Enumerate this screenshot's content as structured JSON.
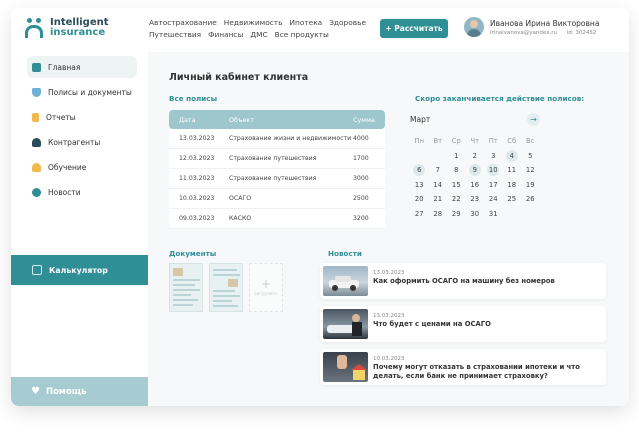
{
  "app": {
    "logo_line1": "Intelligent",
    "logo_line2": "insurance"
  },
  "topnav": [
    "Автострахование",
    "Недвижимость",
    "Ипотека",
    "Здоровье",
    "Путешествия",
    "Финансы",
    "ДМС",
    "Все продукты"
  ],
  "calc_button": "+ Рассчитать",
  "user": {
    "name": "Иванова Ирина Викторовна",
    "email": "irinaivanova@yandex.ru",
    "id": "id: 302452"
  },
  "sidebar": {
    "items": [
      {
        "label": "Главная",
        "icon": "home-icon",
        "color": "#2f8f95"
      },
      {
        "label": "Полисы и документы",
        "icon": "shield-icon",
        "color": "#6fb0d8"
      },
      {
        "label": "Отчеты",
        "icon": "report-icon",
        "color": "#f0b94a"
      },
      {
        "label": "Контрагенты",
        "icon": "person-icon",
        "color": "#2a4b57"
      },
      {
        "label": "Обучение",
        "icon": "learner-icon",
        "color": "#f0b94a"
      },
      {
        "label": "Новости",
        "icon": "globe-icon",
        "color": "#2f8f95"
      }
    ],
    "calculator": "Калькулятор",
    "help": "Помощь"
  },
  "main": {
    "title": "Личный кабинет клиента",
    "policies_title": "Все полисы",
    "policies_columns": [
      "Дата",
      "Объект",
      "Сумма"
    ],
    "policies": [
      {
        "date": "13.03.2023",
        "object": "Страхование жизни и недвижимости",
        "sum": "4000"
      },
      {
        "date": "12.03.2023",
        "object": "Страхование путешествия",
        "sum": "1700"
      },
      {
        "date": "11.03.2023",
        "object": "Страхование путешествия",
        "sum": "3000"
      },
      {
        "date": "10.03.2023",
        "object": "ОСАГО",
        "sum": "2500"
      },
      {
        "date": "09.03.2023",
        "object": "КАСКО",
        "sum": "3200"
      }
    ],
    "expiring_title": "Скоро заканчивается действие полисов:",
    "calendar": {
      "month": "Март",
      "weekdays": [
        "Пн",
        "Вт",
        "Ср",
        "Чт",
        "Пт",
        "Сб",
        "Вс"
      ],
      "offset": 2,
      "days": 31,
      "marked": [
        4,
        6,
        9,
        10
      ]
    },
    "documents_title": "Документы",
    "add_document": "загрузить",
    "news_title": "Новости",
    "news": [
      {
        "date": "13.03.2023",
        "title": "Как оформить ОСАГО на машину без номеров"
      },
      {
        "date": "13.03.2023",
        "title": "Что будет с ценами на ОСАГО"
      },
      {
        "date": "10.03.2023",
        "title": "Почему могут отказать в страховании ипотеки и что делать, если банк не принимает страховку?"
      }
    ]
  }
}
